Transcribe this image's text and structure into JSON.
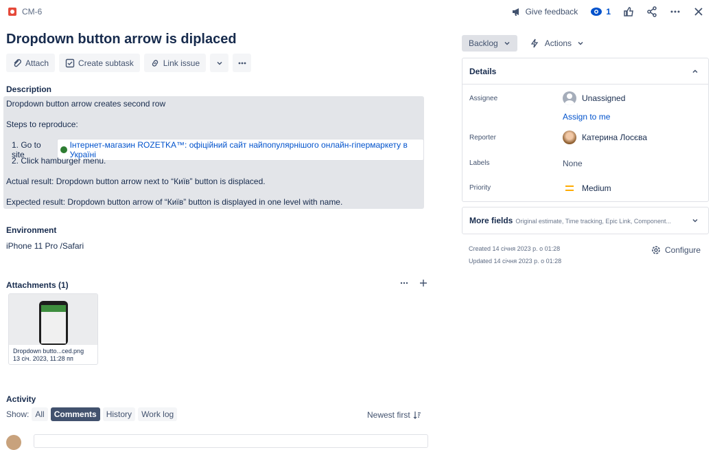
{
  "header": {
    "issue_key": "CM-6",
    "give_feedback": "Give feedback",
    "watch_count": "1"
  },
  "issue": {
    "title": "Dropdown button arrow is diplaced"
  },
  "toolbar": {
    "attach": "Attach",
    "create_subtask": "Create subtask",
    "link_issue": "Link issue"
  },
  "description": {
    "label": "Description",
    "line1": "Dropdown button arrow creates second row",
    "steps_label": "Steps to reproduce:",
    "step1_prefix": "1. Go to site",
    "step1_link": "Інтернет-магазин ROZETKA™: офіційний сайт найпопулярнішого онлайн-гіпермаркету в Україні",
    "step2": "2. Click hamburger menu.",
    "actual": "Actual result: Dropdown button arrow next to “Київ” button is displaced.",
    "expected": "Expected result: Dropdown button arrow of “Київ” button is displayed in one level with name."
  },
  "environment": {
    "label": "Environment",
    "value": "iPhone 11 Pro /Safari"
  },
  "attachments": {
    "label": "Attachments (1)",
    "file_name": "Dropdown butto...ced.png",
    "file_date": "13 січ. 2023, 11:28 пп"
  },
  "activity": {
    "label": "Activity",
    "show_label": "Show:",
    "filters": [
      "All",
      "Comments",
      "History",
      "Work log"
    ],
    "sort": "Newest first"
  },
  "sidebar": {
    "status": "Backlog",
    "actions": "Actions",
    "details_title": "Details",
    "assignee_label": "Assignee",
    "assignee_value": "Unassigned",
    "assign_to_me": "Assign to me",
    "reporter_label": "Reporter",
    "reporter_value": "Катерина Лосєва",
    "labels_label": "Labels",
    "labels_value": "None",
    "priority_label": "Priority",
    "priority_value": "Medium",
    "more_fields": "More fields",
    "more_fields_hint": "Original estimate, Time tracking, Epic Link, Component...",
    "created": "Created 14 січня 2023 р. о 01:28",
    "updated": "Updated 14 січня 2023 р. о 01:28",
    "configure": "Configure"
  },
  "colors": {
    "link": "#0052cc",
    "bug": "#e5493a",
    "priority_medium": "#ffab00",
    "active_filter": "#42526e"
  }
}
